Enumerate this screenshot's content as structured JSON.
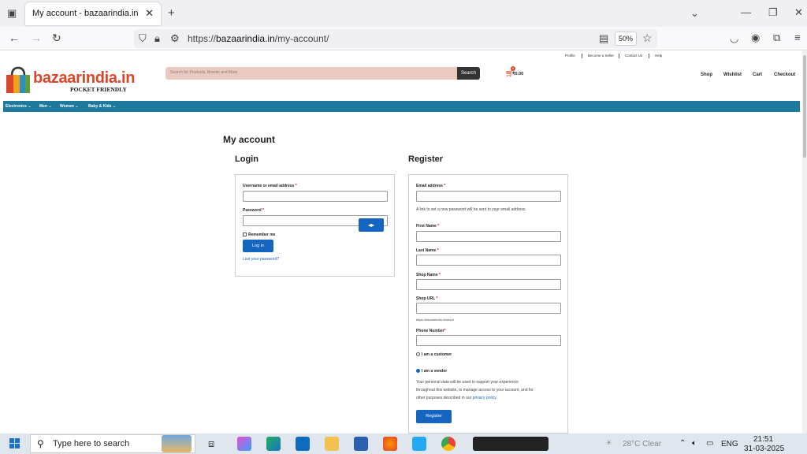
{
  "browser": {
    "tab_title": "My account - bazaarindia.in",
    "new_tab_icon": "plus-icon",
    "url_prefix": "https://",
    "url_host": "bazaarindia.in",
    "url_path": "/my-account/",
    "zoom": "50%"
  },
  "header": {
    "top_links": [
      "Profile",
      "Become a Seller",
      "Contact Us",
      "Help"
    ],
    "logo_text": "bazaarindia.in",
    "logo_tagline": "POCKET FRIENDLY",
    "search_placeholder": "Search for Products, Brands and More",
    "search_button": "Search",
    "cart_badge": "0",
    "cart_amount": "₹0.00",
    "nav": [
      "Shop",
      "Wishlist",
      "Cart",
      "Checkout"
    ]
  },
  "categories": [
    "Electronics",
    "Men",
    "Women",
    "Baby & Kids"
  ],
  "page_title": "My account",
  "login": {
    "heading": "Login",
    "username_label": "Username or email address",
    "password_label": "Password",
    "required_mark": "*",
    "remember_label": "Remember me",
    "login_button": "Log in",
    "lost_password": "Lost your password?"
  },
  "register": {
    "heading": "Register",
    "email_label": "Email address",
    "password_note": "A link to set a new password will be sent to your email address.",
    "first_name_label": "First Name",
    "last_name_label": "Last Name",
    "shop_name_label": "Shop Name",
    "shop_url_label": "Shop URL",
    "shop_url_hint": "https://bazaarindia.in/store/",
    "phone_label": "Phone Number",
    "customer_label": "I am a customer",
    "vendor_label": "I am a vendor",
    "privacy_line1": "Your personal data will be used to support your experience",
    "privacy_line2": "throughout this website, to manage access to your account, and for",
    "privacy_line3": "other purposes described in our",
    "privacy_link": "privacy policy.",
    "register_button": "Register"
  },
  "taskbar": {
    "search_placeholder": "Type here to search",
    "weather": "28°C  Clear",
    "language": "ENG",
    "time": "21:51",
    "date": "31-03-2025"
  },
  "colors": {
    "brand_orange": "#d8472a",
    "category_bar": "#1d7a9c",
    "button_blue": "#1565c0"
  }
}
